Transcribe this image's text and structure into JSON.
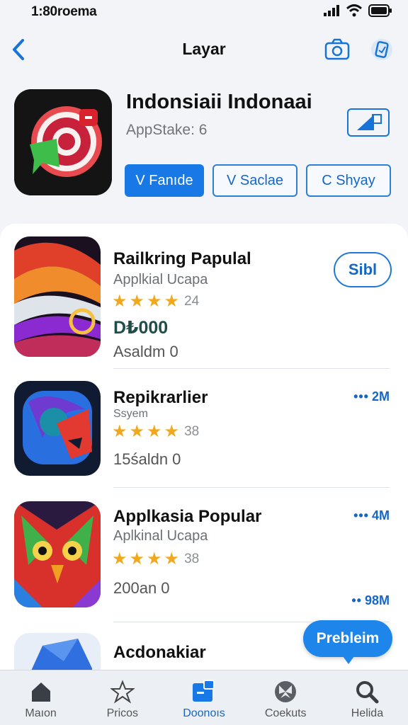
{
  "status_bar": {
    "time": "1:80roema",
    "icons": [
      "signal-icon",
      "wifi-icon",
      "battery-icon"
    ]
  },
  "nav": {
    "title": "Layar",
    "icons": [
      "back-chevron-icon",
      "camera-icon",
      "badge-icon"
    ]
  },
  "hero": {
    "title": "Indonsiaii Indonaai",
    "subtitle": "AppStake: 6",
    "buttons": [
      {
        "label": "V Fanıde",
        "style": "primary"
      },
      {
        "label": "V Saclae",
        "style": "outline"
      },
      {
        "label": "C Shyay",
        "style": "outline"
      }
    ]
  },
  "apps": [
    {
      "name": "Railkring Papulal",
      "subtitle": "Applkial Ucapa",
      "rating_count": "24",
      "price": "D₺000",
      "meta": "Asaldm 0",
      "action": "Sibl"
    },
    {
      "name": "Repikrarlier",
      "subtitle": "Ssyem",
      "rating_count": "38",
      "meta": "15śaldn 0",
      "size": "2M"
    },
    {
      "name": "Applkasia Popular",
      "subtitle": "Aplkinal Ucapa",
      "rating_count": "38",
      "meta": "200an 0",
      "size": "4M",
      "size_bottom": "98M"
    },
    {
      "name": "Acdonakiar"
    }
  ],
  "floating_button": {
    "label": "Prebleim"
  },
  "tabs": [
    {
      "label": "Maıon",
      "icon": "home-icon"
    },
    {
      "label": "Pricos",
      "icon": "star-icon"
    },
    {
      "label": "Doonoıs",
      "icon": "downloads-icon",
      "active": true
    },
    {
      "label": "Coekuts",
      "icon": "butterfly-icon"
    },
    {
      "label": "Helida",
      "icon": "search-icon"
    }
  ],
  "colors": {
    "accent": "#1778e6",
    "star": "#f0a81e",
    "price": "#1e4d4a"
  }
}
